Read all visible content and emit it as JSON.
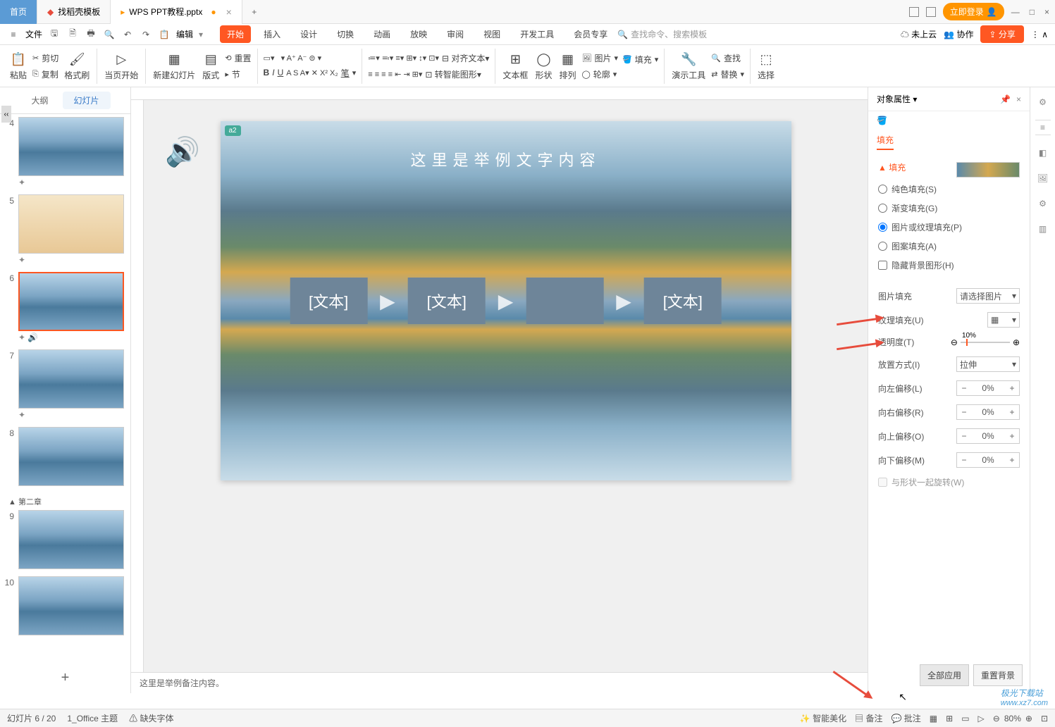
{
  "titlebar": {
    "tabs": [
      {
        "label": "首页"
      },
      {
        "label": "找稻壳模板"
      },
      {
        "label": "WPS PPT教程.pptx"
      }
    ],
    "login": "立即登录",
    "grid_icon": "⊞"
  },
  "menubar": {
    "file": "文件",
    "edit": "编辑",
    "tabs": [
      "开始",
      "插入",
      "设计",
      "切换",
      "动画",
      "放映",
      "审阅",
      "视图",
      "开发工具",
      "会员专享"
    ],
    "search_placeholder": "查找命令、搜索模板",
    "cloud": "未上云",
    "collab": "协作",
    "share": "分享"
  },
  "ribbon": {
    "paste": "粘贴",
    "cut": "剪切",
    "copy": "复制",
    "format_painter": "格式刷",
    "from_current": "当页开始",
    "new_slide": "新建幻灯片",
    "layout": "版式",
    "section": "节",
    "reset": "重置",
    "align_text": "对齐文本",
    "smart_graphic": "转智能图形",
    "textbox": "文本框",
    "shapes": "形状",
    "arrange": "排列",
    "pictures": "图片",
    "fill": "填充",
    "outline_btn": "轮廓",
    "tools": "演示工具",
    "find": "查找",
    "replace": "替换",
    "select": "选择"
  },
  "outline": {
    "tab_outline": "大纲",
    "tab_slides": "幻灯片",
    "section": "▲ 第二章",
    "visible_nums": [
      "4",
      "5",
      "6",
      "7",
      "8",
      "9",
      "10"
    ]
  },
  "canvas": {
    "slide_title": "这里是举例文字内容",
    "box1": "[文本]",
    "box2": "[文本]",
    "box3": "",
    "box4": "[文本]",
    "notes": "这里是举例备注内容。",
    "marker": "a2"
  },
  "props": {
    "title": "对象属性",
    "tab_fill": "填充",
    "section_fill": "填充",
    "radio_solid": "纯色填充(S)",
    "radio_gradient": "渐变填充(G)",
    "radio_picture": "图片或纹理填充(P)",
    "radio_pattern": "图案填充(A)",
    "chk_hide_bg": "隐藏背景图形(H)",
    "pic_fill": "图片填充",
    "pic_fill_val": "请选择图片",
    "texture": "纹理填充(U)",
    "opacity": "透明度(T)",
    "opacity_val": "10%",
    "placement": "放置方式(I)",
    "placement_val": "拉伸",
    "offset_l": "向左偏移(L)",
    "offset_r": "向右偏移(R)",
    "offset_t": "向上偏移(O)",
    "offset_b": "向下偏移(M)",
    "offset_val": "0%",
    "rotate_chk": "与形状一起旋转(W)",
    "apply_all": "全部应用",
    "reset_bg": "重置背景"
  },
  "statusbar": {
    "slide_pos": "幻灯片 6 / 20",
    "theme": "1_Office 主题",
    "missing_font": "缺失字体",
    "beautify": "智能美化",
    "notes": "备注",
    "comments": "批注",
    "zoom": "80%"
  },
  "watermark": {
    "line1": "极光下载站",
    "line2": "www.xz7.com"
  }
}
